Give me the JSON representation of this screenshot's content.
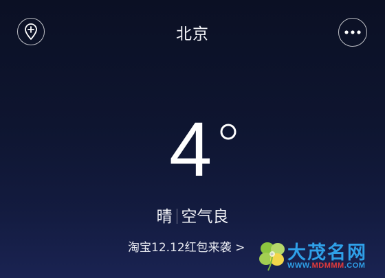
{
  "header": {
    "city": "北京",
    "add_icon": "add-location-icon",
    "more_icon": "more-dots-icon"
  },
  "current": {
    "temperature": "4",
    "degree_symbol": "°",
    "condition": "晴",
    "air_quality": "空气良"
  },
  "promo": {
    "text": "淘宝12.12红包来袭",
    "arrow": ">"
  },
  "watermark": {
    "name": "大茂名网",
    "url_prefix": "WWW.",
    "url_highlight": "MDMMM",
    "url_suffix": ".COM"
  },
  "colors": {
    "bg_top": "#0b1024",
    "bg_bottom": "#1a2352",
    "watermark_blue": "#2fa0e8",
    "watermark_red": "#e53b3b"
  }
}
